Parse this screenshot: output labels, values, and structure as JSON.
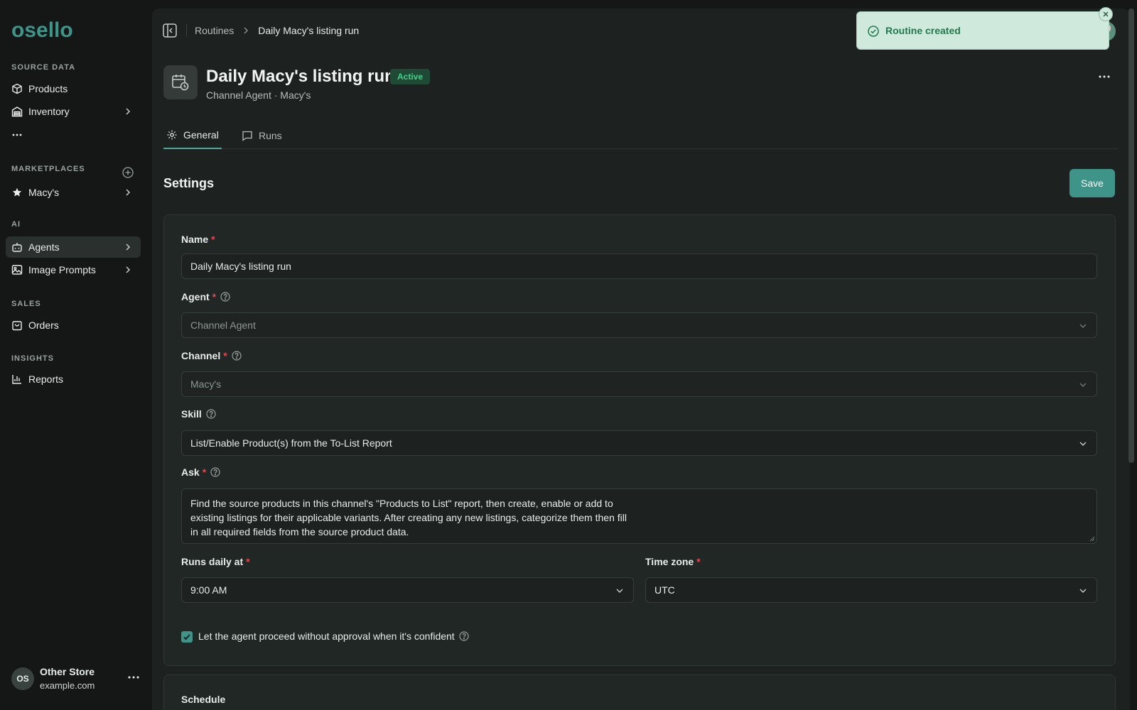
{
  "logo": {
    "text": "osello"
  },
  "sidebar": {
    "sections": {
      "source_data": "SOURCE DATA",
      "marketplaces": "MARKETPLACES",
      "ai": "AI",
      "sales": "SALES",
      "insights": "INSIGHTS"
    },
    "items": {
      "products": "Products",
      "inventory": "Inventory",
      "more": "...",
      "macys": "Macy's",
      "agents": "Agents",
      "image_prompts": "Image Prompts",
      "orders": "Orders",
      "reports": "Reports"
    },
    "active_item": "Agents",
    "user": {
      "initials": "OS",
      "name": "Other Store",
      "domain": "example.com"
    }
  },
  "breadcrumb": {
    "parent": "Routines",
    "current": "Daily Macy's listing run"
  },
  "header": {
    "title": "Daily Macy's listing run",
    "status": "Active",
    "subtitle": "Channel Agent · Macy's"
  },
  "tabs": [
    {
      "label": "General",
      "active": true,
      "icon": "gear-icon"
    },
    {
      "label": "Runs",
      "active": false,
      "icon": "chat-icon"
    }
  ],
  "settings": {
    "title": "Settings",
    "save_label": "Save",
    "name": {
      "label": "Name",
      "value": "Daily Macy's listing run"
    },
    "agent": {
      "label": "Agent",
      "value": "Channel Agent"
    },
    "channel": {
      "label": "Channel",
      "value": "Macy's"
    },
    "skill": {
      "label": "Skill",
      "value": "List/Enable Product(s) from the To-List Report"
    },
    "ask": {
      "label": "Ask",
      "value": "Find the source products in this channel's \"Products to List\" report, then create, enable or add to existing listings for their applicable variants. After creating any new listings, categorize them then fill in all required fields from the source product data."
    },
    "runs_daily_at": {
      "label": "Runs daily at",
      "value": "9:00 AM"
    },
    "time_zone": {
      "label": "Time zone",
      "value": "UTC"
    },
    "auto_approve": {
      "label": "Let the agent proceed without approval when it's confident",
      "checked": true
    }
  },
  "schedule": {
    "title": "Schedule"
  },
  "toast": {
    "message": "Routine created"
  },
  "colors": {
    "accent": "#3e9488",
    "active_badge": "#44d08a",
    "required": "#e5484d",
    "toast_bg": "#cfe9dc"
  }
}
